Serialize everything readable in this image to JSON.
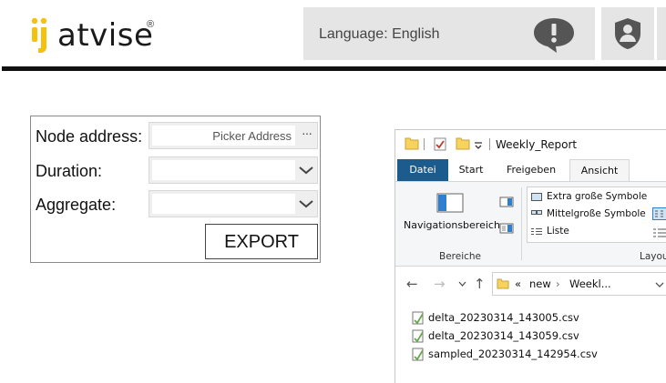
{
  "header": {
    "logo_text": "atvise",
    "logo_registered": "®",
    "language_label": "Language: English"
  },
  "export_form": {
    "node_address": {
      "label": "Node address:",
      "picker_text": "Picker Address",
      "picker_button": "···"
    },
    "duration": {
      "label": "Duration:",
      "value": ""
    },
    "aggregate": {
      "label": "Aggregate:",
      "value": ""
    },
    "export_button": "EXPORT"
  },
  "explorer": {
    "title": "Weekly_Report",
    "tabs": [
      "Datei",
      "Start",
      "Freigeben",
      "Ansicht"
    ],
    "ribbon": {
      "navigation_pane": "Navigationsbereich",
      "group_panes": "Bereiche",
      "group_layout": "Layou",
      "layout_options": [
        "Extra große Symbole",
        "Mittelgroße Symbole",
        "Liste"
      ]
    },
    "address": {
      "overflow": "«",
      "crumbs": [
        "new",
        "Weekl..."
      ]
    },
    "files": [
      "delta_20230314_143005.csv",
      "delta_20230314_143059.csv",
      "sampled_20230314_142954.csv"
    ]
  },
  "colors": {
    "logo_yellow": "#f4c20d",
    "header_gray": "#e5e5e5",
    "icon_dark": "#555555",
    "ribbon_active_tab": "#1c5c8c",
    "folder_yellow": "#f7d35c"
  }
}
